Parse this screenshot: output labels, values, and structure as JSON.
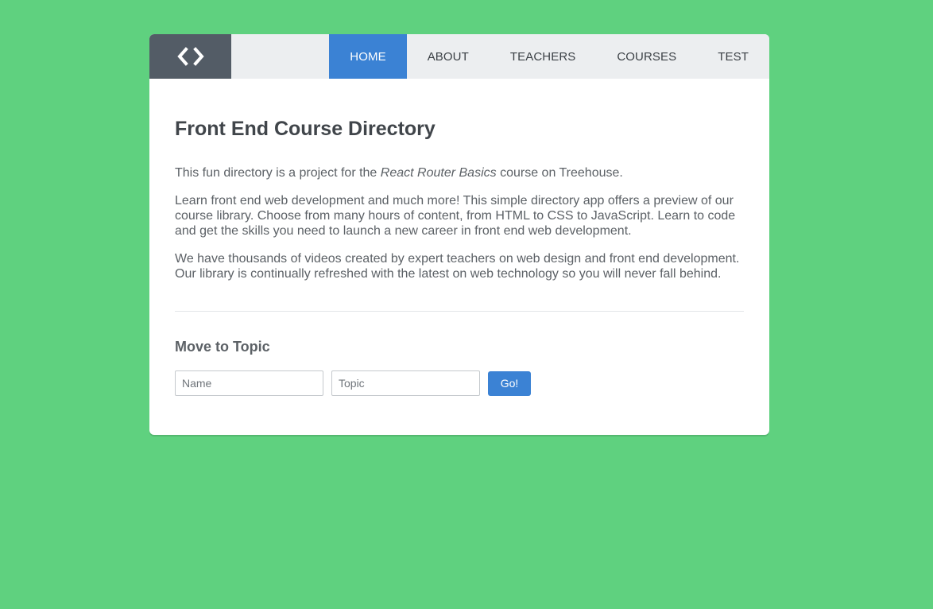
{
  "logo": {
    "icon": "code-brackets-icon"
  },
  "nav": {
    "items": [
      {
        "label": "HOME",
        "active": true
      },
      {
        "label": "ABOUT",
        "active": false
      },
      {
        "label": "TEACHERS",
        "active": false
      },
      {
        "label": "COURSES",
        "active": false
      },
      {
        "label": "TEST",
        "active": false
      }
    ]
  },
  "main": {
    "title": "Front End Course Directory",
    "intro": {
      "before": "This fun directory is a project for the ",
      "emphasis": "React Router Basics",
      "after": " course on Treehouse."
    },
    "paragraph2": "Learn front end web development and much more! This simple directory app offers a preview of our course library. Choose from many hours of content, from HTML to CSS to JavaScript. Learn to code and get the skills you need to launch a new career in front end web development.",
    "paragraph3": "We have thousands of videos created by expert teachers on web design and front end development. Our library is continually refreshed with the latest on web technology so you will never fall behind."
  },
  "topic_form": {
    "heading": "Move to Topic",
    "name_placeholder": "Name",
    "name_value": "",
    "topic_placeholder": "Topic",
    "topic_value": "",
    "submit_label": "Go!"
  },
  "colors": {
    "background": "#5fd17f",
    "accent": "#3b82d4",
    "logo_bg": "#535c66",
    "header_bg": "#eceef0"
  }
}
